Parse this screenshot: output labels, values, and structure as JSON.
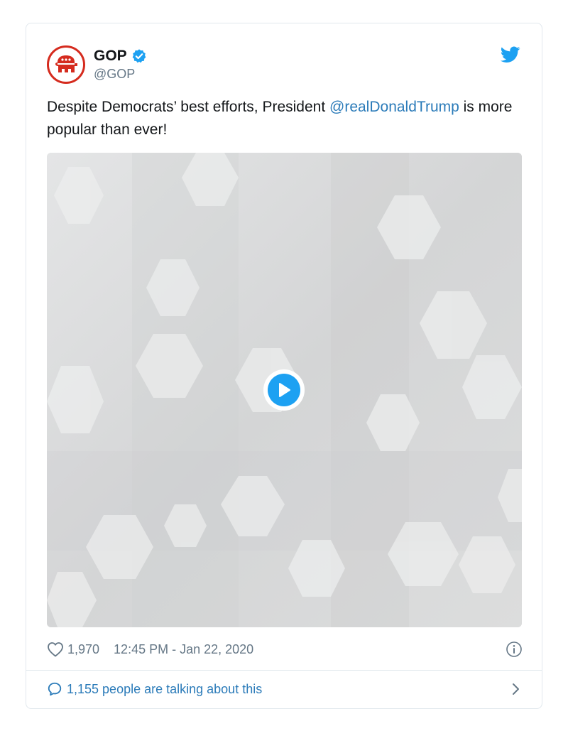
{
  "author": {
    "display_name": "GOP",
    "handle": "@GOP",
    "avatar_icon": "republican-elephant-icon",
    "verified_icon": "verified-badge-icon"
  },
  "tweet": {
    "text_before": "Despite Democrats’ best efforts, President ",
    "mention": "@realDonaldTrump",
    "text_after": " is more popular than ever!"
  },
  "media": {
    "type": "video",
    "play_icon": "play-icon"
  },
  "meta": {
    "like_icon": "heart-icon",
    "like_count": "1,970",
    "timestamp": "12:45 PM - Jan 22, 2020",
    "info_icon": "info-icon"
  },
  "conversation": {
    "icon": "comment-bubble-icon",
    "label": "1,155 people are talking about this",
    "chevron_icon": "chevron-right-icon"
  },
  "colors": {
    "accent": "#1da1f2",
    "link": "#2b7bb9",
    "brand_red": "#d52b1e",
    "muted": "#657786",
    "border": "#e1e8ed"
  }
}
